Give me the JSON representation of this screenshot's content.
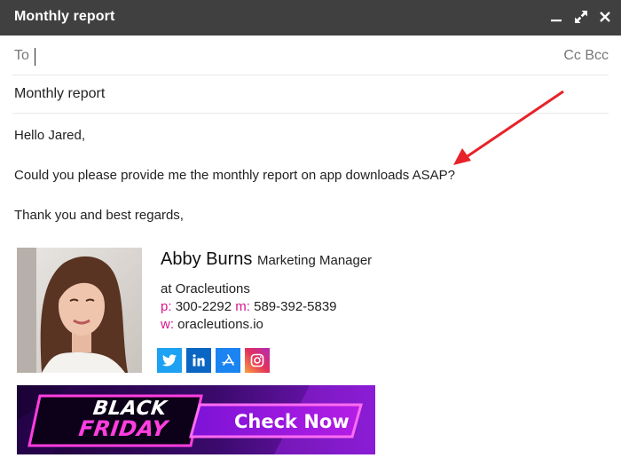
{
  "window": {
    "title": "Monthly report"
  },
  "compose": {
    "to_label": "To",
    "cc_bcc_label": "Cc Bcc",
    "subject": "Monthly report",
    "body": [
      "Hello Jared,",
      "Could you please provide me the monthly report on app downloads ASAP?",
      "Thank you and best regards,"
    ]
  },
  "signature": {
    "name": "Abby Burns",
    "title": "Marketing Manager",
    "company": "at Oracleutions",
    "phone_prefix": "p:",
    "phone": "300-2292",
    "mobile_prefix": "m:",
    "mobile": "589-392-5839",
    "web_prefix": "w:",
    "web": "oracleutions.io",
    "social_icons": [
      "twitter-icon",
      "linkedin-icon",
      "app-store-icon",
      "instagram-icon"
    ]
  },
  "banner": {
    "line1": "BLACK",
    "line2": "FRIDAY",
    "cta": "Check Now"
  },
  "colors": {
    "titlebar": "#404040",
    "accent": "#d6148c",
    "arrow": "#e8222a",
    "twitter": "#1da1f2",
    "linkedin": "#0a66c2",
    "appstore": "#1b84f0",
    "banner_neon": "#ff3ee0"
  }
}
